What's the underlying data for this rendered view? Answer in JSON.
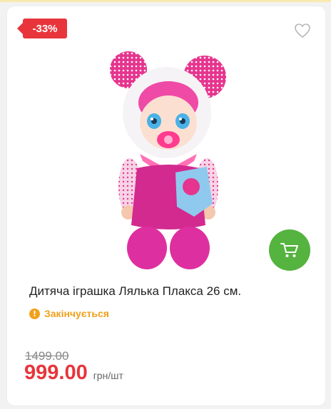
{
  "product": {
    "discount_badge": "-33%",
    "title": "Дитяча іграшка Лялька Плакса 26 см.",
    "status": "Закінчується",
    "status_icon_glyph": "!",
    "old_price": "1499.00",
    "price": "999.00",
    "unit": "грн/шт"
  },
  "icons": {
    "favorite": "heart-outline-icon",
    "cart": "shopping-cart-icon",
    "status": "exclamation-circle-icon"
  },
  "colors": {
    "accent_red": "#e8353b",
    "cart_green": "#55b33f",
    "status_orange": "#f0a11c",
    "doll_pink": "#e6358f"
  }
}
